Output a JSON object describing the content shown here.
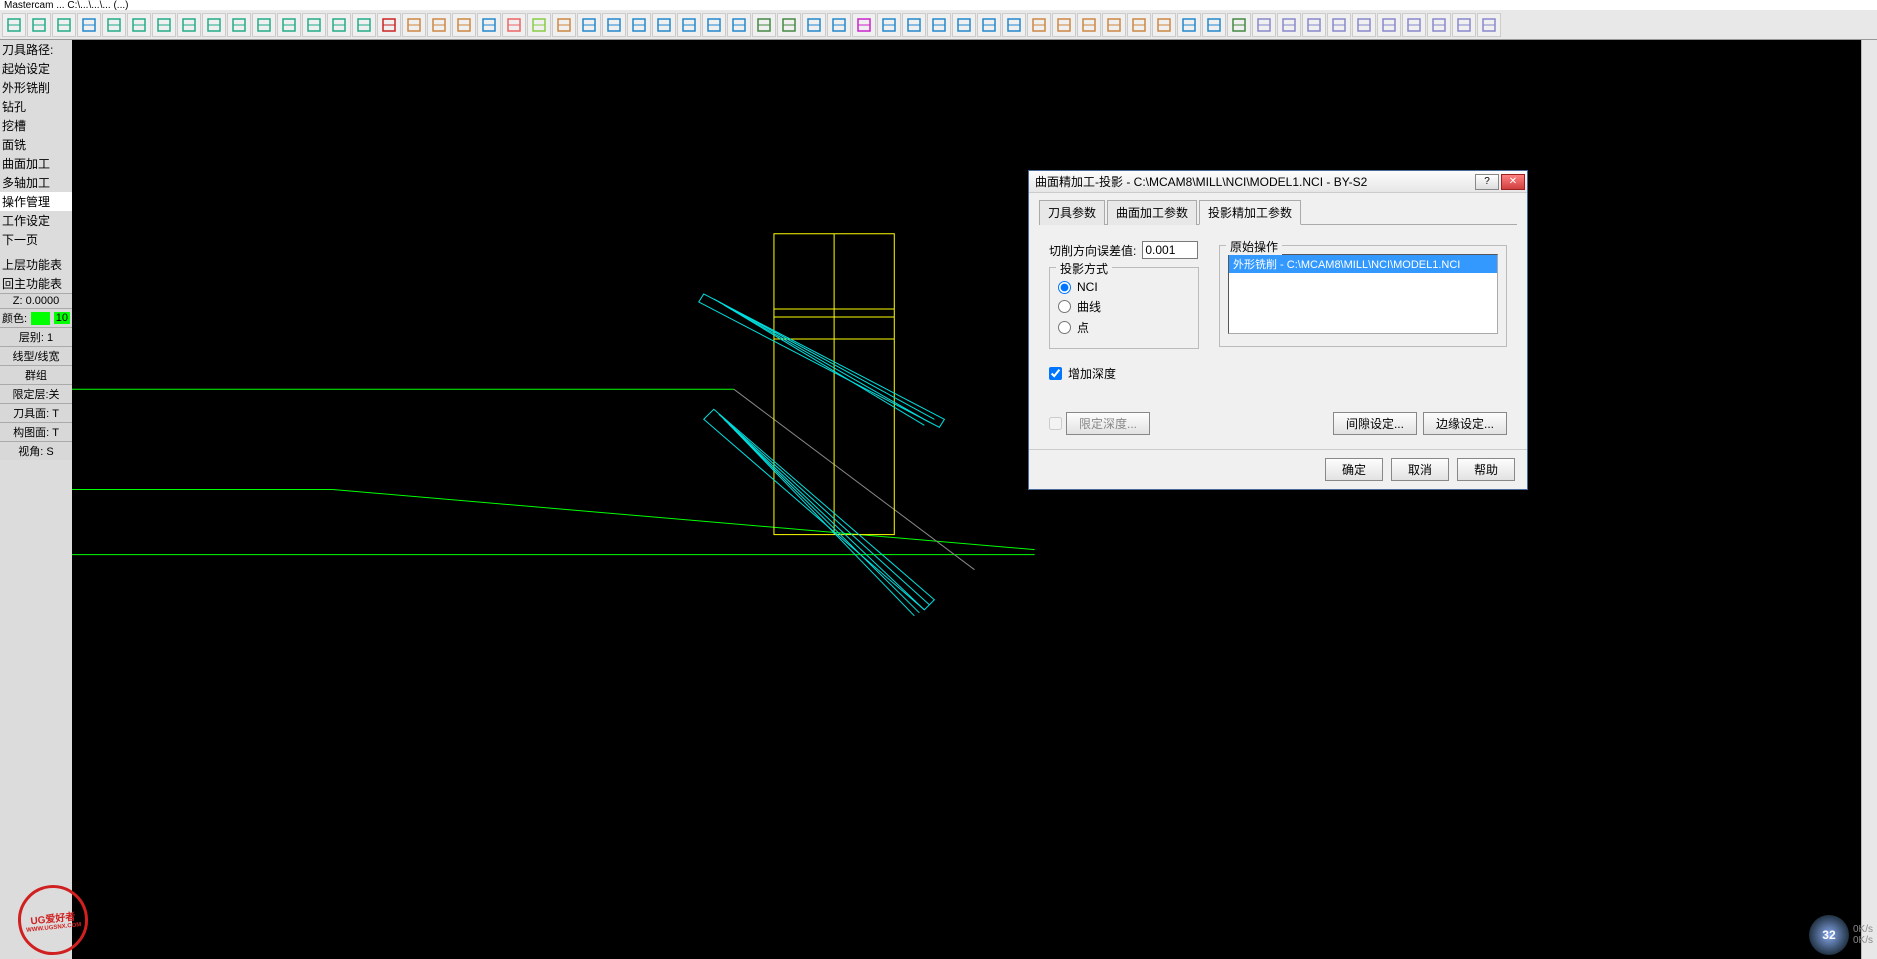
{
  "titlebar": {
    "text": "Mastercam ... C:\\...\\...\\... (...)"
  },
  "side_panel": {
    "items": [
      "刀具路径:",
      "起始设定",
      "外形铣削",
      "钻孔",
      "挖槽",
      "面铣",
      "曲面加工",
      "多轴加工",
      "操作管理",
      "工作设定",
      "下一页",
      "",
      "上层功能表",
      "回主功能表"
    ],
    "selected_index": 8,
    "status": {
      "z": "Z:   0.0000",
      "color_label": "颜色:",
      "color_value": "10",
      "level": "层别:  1",
      "linetype": "线型/线宽",
      "group": "群组",
      "limit": "限定层:关",
      "tool_face": "刀具面: T",
      "wcs_face": "构图面: T",
      "view": "视角:   S"
    }
  },
  "dialog": {
    "title": "曲面精加工-投影 - C:\\MCAM8\\MILL\\NCI\\MODEL1.NCI - BY-S2",
    "tabs": [
      "刀具参数",
      "曲面加工参数",
      "投影精加工参数"
    ],
    "active_tab": 2,
    "tolerance_label": "切削方向误差值:",
    "tolerance_value": "0.001",
    "proj_method": {
      "legend": "投影方式",
      "options": [
        "NCI",
        "曲线",
        "点"
      ],
      "selected": 0
    },
    "source_ops": {
      "legend": "原始操作",
      "item": "外形铣削 - C:\\MCAM8\\MILL\\NCI\\MODEL1.NCI"
    },
    "add_depth": {
      "label": "增加深度",
      "checked": true
    },
    "limit_depth": {
      "label": "限定深度...",
      "checked": false
    },
    "gap_button": "间隙设定...",
    "edge_button": "边缘设定...",
    "footer": {
      "ok": "确定",
      "cancel": "取消",
      "help": "帮助"
    }
  },
  "net": {
    "gauge": "32",
    "up": "0K/s",
    "down": "0K/s"
  },
  "watermark": {
    "line1": "UG爱好者",
    "line2": "WWW.UGSNX.COM"
  }
}
